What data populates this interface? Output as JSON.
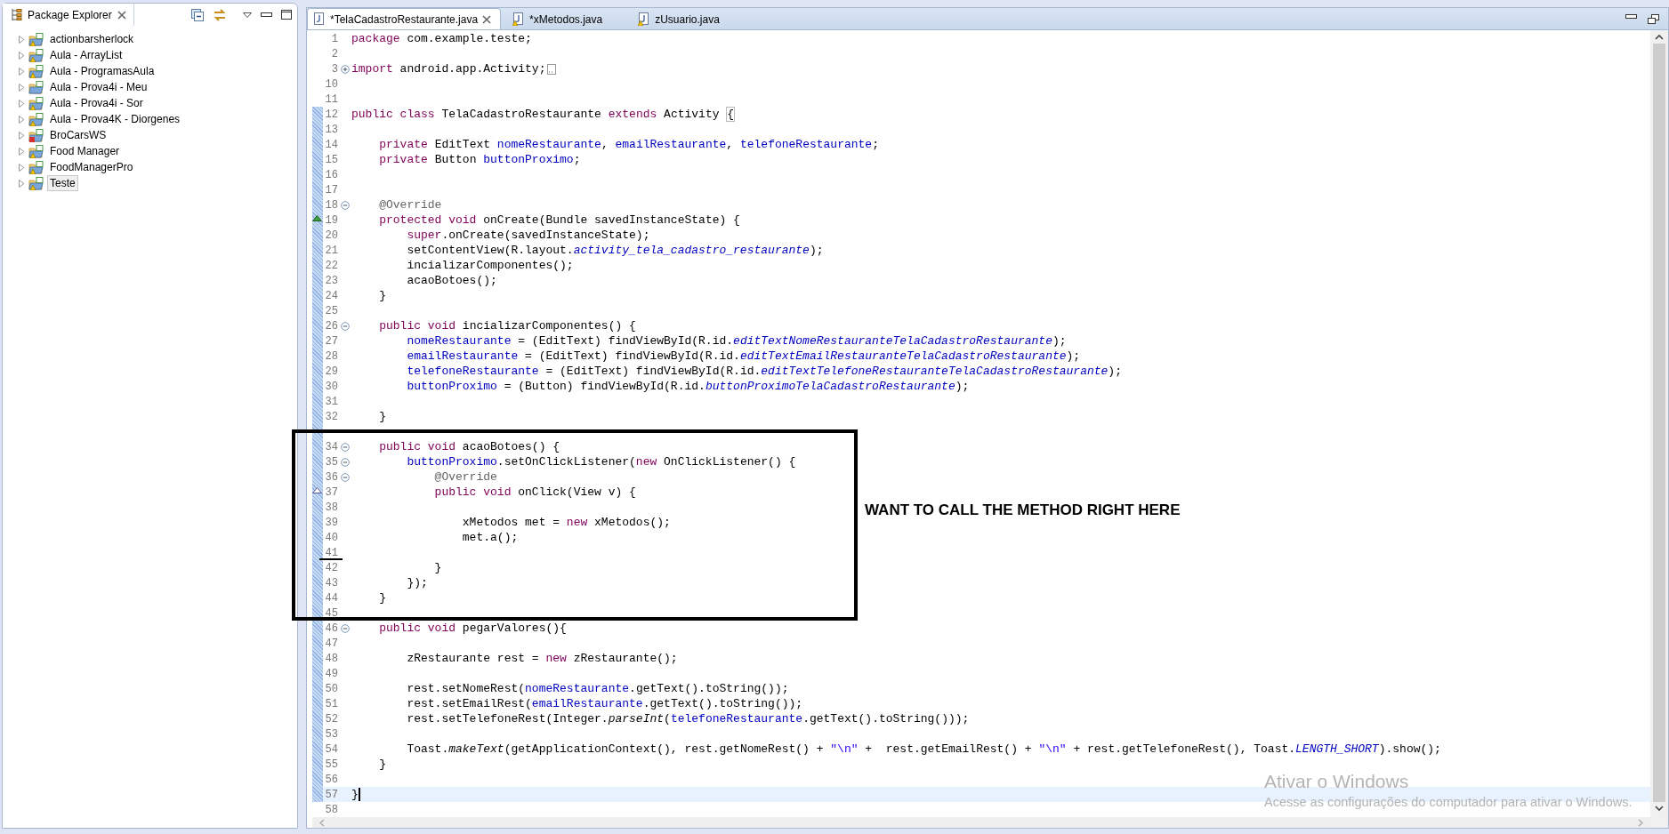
{
  "package_explorer": {
    "title": "Package Explorer",
    "projects": [
      {
        "label": "actionbarsherlock",
        "kind": "warning",
        "selected": false,
        "expanded": false
      },
      {
        "label": "Aula - ArrayList",
        "kind": "warning",
        "selected": false,
        "expanded": false
      },
      {
        "label": "Aula - ProgramasAula",
        "kind": "warning",
        "selected": false,
        "expanded": false
      },
      {
        "label": "Aula - Prova4i - Meu",
        "kind": "plain",
        "selected": false,
        "expanded": false
      },
      {
        "label": "Aula - Prova4i - Sor",
        "kind": "warning",
        "selected": false,
        "expanded": false
      },
      {
        "label": "Aula - Prova4K - Diorgenes",
        "kind": "warning",
        "selected": false,
        "expanded": false
      },
      {
        "label": "BroCarsWS",
        "kind": "error",
        "selected": false,
        "expanded": false
      },
      {
        "label": "Food Manager",
        "kind": "warning",
        "selected": false,
        "expanded": false
      },
      {
        "label": "FoodManagerPro",
        "kind": "warning",
        "selected": false,
        "expanded": false
      },
      {
        "label": "Teste",
        "kind": "warning",
        "selected": true,
        "expanded": false
      }
    ]
  },
  "editor": {
    "tabs": [
      {
        "label": "*TelaCadastroRestaurante.java",
        "kind": "java",
        "selected": true
      },
      {
        "label": "*xMetodos.java",
        "kind": "java_warning",
        "selected": false
      },
      {
        "label": "zUsuario.java",
        "kind": "java_warning",
        "selected": false
      }
    ],
    "lines": [
      {
        "number": "1",
        "changed": false,
        "current": false,
        "code": [
          {
            "kind": "keyword",
            "text": "package"
          },
          {
            "kind": "plain",
            "text": " com.example.teste;"
          }
        ]
      },
      {
        "number": "2",
        "changed": false,
        "current": false
      },
      {
        "number": "3",
        "changed": false,
        "current": false,
        "fold": {
          "kind": "collapsed"
        },
        "code": [
          {
            "kind": "keyword",
            "text": "import"
          },
          {
            "kind": "plain",
            "text": " android.app.Activity;"
          }
        ]
      },
      {
        "number": "10",
        "changed": false,
        "current": false
      },
      {
        "number": "11",
        "changed": false,
        "current": false
      },
      {
        "number": "12",
        "changed": true,
        "current": false,
        "code": [
          {
            "kind": "keyword",
            "text": "public class"
          },
          {
            "kind": "plain",
            "text": " TelaCadastroRestaurante "
          },
          {
            "kind": "keyword",
            "text": "extends"
          },
          {
            "kind": "plain",
            "text": " Activity "
          },
          {
            "kind": "bracket",
            "text": "{"
          }
        ]
      },
      {
        "number": "13",
        "changed": true,
        "current": false
      },
      {
        "number": "14",
        "changed": true,
        "current": false,
        "code": [
          {
            "kind": "keyword",
            "text": "    private"
          },
          {
            "kind": "plain",
            "text": " EditText "
          },
          {
            "kind": "field",
            "text": "nomeRestaurante"
          },
          {
            "kind": "plain",
            "text": ", "
          },
          {
            "kind": "field",
            "text": "emailRestaurante"
          },
          {
            "kind": "plain",
            "text": ", "
          },
          {
            "kind": "field",
            "text": "telefoneRestaurante"
          },
          {
            "kind": "plain",
            "text": ";"
          }
        ]
      },
      {
        "number": "15",
        "changed": true,
        "current": false,
        "code": [
          {
            "kind": "keyword",
            "text": "    private"
          },
          {
            "kind": "plain",
            "text": " Button "
          },
          {
            "kind": "field",
            "text": "buttonProximo"
          },
          {
            "kind": "plain",
            "text": ";"
          }
        ]
      },
      {
        "number": "16",
        "changed": true,
        "current": false
      },
      {
        "number": "17",
        "changed": true,
        "current": false
      },
      {
        "number": "18",
        "changed": true,
        "current": false,
        "fold": {
          "kind": "expanded"
        },
        "code": [
          {
            "kind": "annotation",
            "text": "    @Override"
          }
        ]
      },
      {
        "number": "19",
        "changed": true,
        "current": false,
        "marker": {
          "kind": "override"
        },
        "code": [
          {
            "kind": "keyword",
            "text": "    protected void"
          },
          {
            "kind": "plain",
            "text": " onCreate(Bundle savedInstanceState) {"
          }
        ]
      },
      {
        "number": "20",
        "changed": true,
        "current": false,
        "code": [
          {
            "kind": "keyword",
            "text": "        super"
          },
          {
            "kind": "plain",
            "text": ".onCreate(savedInstanceState);"
          }
        ]
      },
      {
        "number": "21",
        "changed": true,
        "current": false,
        "code": [
          {
            "kind": "plain",
            "text": "        setContentView(R.layout."
          },
          {
            "kind": "constant",
            "text": "activity_tela_cadastro_restaurante"
          },
          {
            "kind": "plain",
            "text": ");"
          }
        ]
      },
      {
        "number": "22",
        "changed": true,
        "current": false,
        "code": [
          {
            "kind": "plain",
            "text": "        incializarComponentes();"
          }
        ]
      },
      {
        "number": "23",
        "changed": true,
        "current": false,
        "code": [
          {
            "kind": "plain",
            "text": "        acaoBotoes();"
          }
        ]
      },
      {
        "number": "24",
        "changed": true,
        "current": false,
        "code": [
          {
            "kind": "plain",
            "text": "    }"
          }
        ]
      },
      {
        "number": "25",
        "changed": true,
        "current": false
      },
      {
        "number": "26",
        "changed": true,
        "current": false,
        "fold": {
          "kind": "expanded"
        },
        "code": [
          {
            "kind": "keyword",
            "text": "    public void"
          },
          {
            "kind": "plain",
            "text": " incializarComponentes() {"
          }
        ]
      },
      {
        "number": "27",
        "changed": true,
        "current": false,
        "code": [
          {
            "kind": "field",
            "text": "        nomeRestaurante"
          },
          {
            "kind": "plain",
            "text": " = (EditText) findViewById(R.id."
          },
          {
            "kind": "constant",
            "text": "editTextNomeRestauranteTelaCadastroRestaurante"
          },
          {
            "kind": "plain",
            "text": ");"
          }
        ]
      },
      {
        "number": "28",
        "changed": true,
        "current": false,
        "code": [
          {
            "kind": "field",
            "text": "        emailRestaurante"
          },
          {
            "kind": "plain",
            "text": " = (EditText) findViewById(R.id."
          },
          {
            "kind": "constant",
            "text": "editTextEmailRestauranteTelaCadastroRestaurante"
          },
          {
            "kind": "plain",
            "text": ");"
          }
        ]
      },
      {
        "number": "29",
        "changed": true,
        "current": false,
        "code": [
          {
            "kind": "field",
            "text": "        telefoneRestaurante"
          },
          {
            "kind": "plain",
            "text": " = (EditText) findViewById(R.id."
          },
          {
            "kind": "constant",
            "text": "editTextTelefoneRestauranteTelaCadastroRestaurante"
          },
          {
            "kind": "plain",
            "text": ");"
          }
        ]
      },
      {
        "number": "30",
        "changed": true,
        "current": false,
        "code": [
          {
            "kind": "field",
            "text": "        buttonProximo"
          },
          {
            "kind": "plain",
            "text": " = (Button) findViewById(R.id."
          },
          {
            "kind": "constant",
            "text": "buttonProximoTelaCadastroRestaurante"
          },
          {
            "kind": "plain",
            "text": ");"
          }
        ]
      },
      {
        "number": "31",
        "changed": true,
        "current": false
      },
      {
        "number": "32",
        "changed": true,
        "current": false,
        "code": [
          {
            "kind": "plain",
            "text": "    }"
          }
        ]
      },
      {
        "changed": true,
        "current": false
      },
      {
        "number": "34",
        "changed": true,
        "current": false,
        "fold": {
          "kind": "expanded"
        },
        "code": [
          {
            "kind": "keyword",
            "text": "    public void"
          },
          {
            "kind": "plain",
            "text": " acaoBotoes() {"
          }
        ]
      },
      {
        "number": "35",
        "changed": true,
        "current": false,
        "fold": {
          "kind": "expanded"
        },
        "code": [
          {
            "kind": "field",
            "text": "        buttonProximo"
          },
          {
            "kind": "plain",
            "text": ".setOnClickListener("
          },
          {
            "kind": "keyword",
            "text": "new"
          },
          {
            "kind": "plain",
            "text": " OnClickListener() {"
          }
        ]
      },
      {
        "number": "36",
        "changed": true,
        "current": false,
        "fold": {
          "kind": "expanded"
        },
        "code": [
          {
            "kind": "annotation",
            "text": "            @Override"
          }
        ]
      },
      {
        "number": "37",
        "changed": true,
        "current": false,
        "marker": {
          "kind": "implements"
        },
        "code": [
          {
            "kind": "keyword",
            "text": "            public void"
          },
          {
            "kind": "plain",
            "text": " onClick(View v) {"
          }
        ]
      },
      {
        "number": "38",
        "changed": true,
        "current": false
      },
      {
        "number": "39",
        "changed": true,
        "current": false,
        "code": [
          {
            "kind": "plain",
            "text": "                xMetodos met = "
          },
          {
            "kind": "keyword",
            "text": "new"
          },
          {
            "kind": "plain",
            "text": " xMetodos();"
          }
        ]
      },
      {
        "number": "40",
        "changed": true,
        "current": false,
        "code": [
          {
            "kind": "plain",
            "text": "                met.a();"
          }
        ]
      },
      {
        "number": "41",
        "changed": true,
        "current": false,
        "marker": {
          "kind": "deletion"
        }
      },
      {
        "number": "42",
        "changed": true,
        "current": false,
        "code": [
          {
            "kind": "plain",
            "text": "            }"
          }
        ]
      },
      {
        "number": "43",
        "changed": true,
        "current": false,
        "code": [
          {
            "kind": "plain",
            "text": "        });"
          }
        ]
      },
      {
        "number": "44",
        "changed": true,
        "current": false,
        "code": [
          {
            "kind": "plain",
            "text": "    }"
          }
        ]
      },
      {
        "number": "45",
        "changed": true,
        "current": false
      },
      {
        "number": "46",
        "changed": true,
        "current": false,
        "fold": {
          "kind": "expanded"
        },
        "code": [
          {
            "kind": "keyword",
            "text": "    public void"
          },
          {
            "kind": "plain",
            "text": " pegarValores(){"
          }
        ]
      },
      {
        "number": "47",
        "changed": true,
        "current": false
      },
      {
        "number": "48",
        "changed": true,
        "current": false,
        "code": [
          {
            "kind": "plain",
            "text": "        zRestaurante rest = "
          },
          {
            "kind": "keyword",
            "text": "new"
          },
          {
            "kind": "plain",
            "text": " zRestaurante();"
          }
        ]
      },
      {
        "number": "49",
        "changed": true,
        "current": false
      },
      {
        "number": "50",
        "changed": true,
        "current": false,
        "code": [
          {
            "kind": "plain",
            "text": "        rest.setNomeRest("
          },
          {
            "kind": "field",
            "text": "nomeRestaurante"
          },
          {
            "kind": "plain",
            "text": ".getText().toString());"
          }
        ]
      },
      {
        "number": "51",
        "changed": true,
        "current": false,
        "code": [
          {
            "kind": "plain",
            "text": "        rest.setEmailRest("
          },
          {
            "kind": "field",
            "text": "emailRestaurante"
          },
          {
            "kind": "plain",
            "text": ".getText().toString());"
          }
        ]
      },
      {
        "number": "52",
        "changed": true,
        "current": false,
        "code": [
          {
            "kind": "plain",
            "text": "        rest.setTelefoneRest(Integer."
          },
          {
            "kind": "static",
            "text": "parseInt"
          },
          {
            "kind": "plain",
            "text": "("
          },
          {
            "kind": "field",
            "text": "telefoneRestaurante"
          },
          {
            "kind": "plain",
            "text": ".getText().toString()));"
          }
        ]
      },
      {
        "number": "53",
        "changed": true,
        "current": false
      },
      {
        "number": "54",
        "changed": true,
        "current": false,
        "code": [
          {
            "kind": "plain",
            "text": "        Toast."
          },
          {
            "kind": "static",
            "text": "makeText"
          },
          {
            "kind": "plain",
            "text": "(getApplicationContext(), rest.getNomeRest() + "
          },
          {
            "kind": "string",
            "text": "\"\\n\""
          },
          {
            "kind": "plain",
            "text": " +  rest.getEmailRest() + "
          },
          {
            "kind": "string",
            "text": "\"\\n\""
          },
          {
            "kind": "plain",
            "text": " + rest.getTelefoneRest(), Toast."
          },
          {
            "kind": "constant",
            "text": "LENGTH_SHORT"
          },
          {
            "kind": "plain",
            "text": ").show();"
          }
        ]
      },
      {
        "number": "55",
        "changed": true,
        "current": false,
        "code": [
          {
            "kind": "plain",
            "text": "    }"
          }
        ]
      },
      {
        "number": "56",
        "changed": true,
        "current": false
      },
      {
        "number": "57",
        "changed": true,
        "current": true,
        "code": [
          {
            "kind": "plain",
            "text": "}"
          }
        ]
      },
      {
        "number": "58",
        "changed": false,
        "current": false
      }
    ]
  },
  "annotation": {
    "text": "WANT TO CALL THE METHOD RIGHT HERE"
  },
  "activation_notice": {
    "title": "Ativar o Windows",
    "message": "Acesse as configurações do computador para ativar o Windows."
  }
}
